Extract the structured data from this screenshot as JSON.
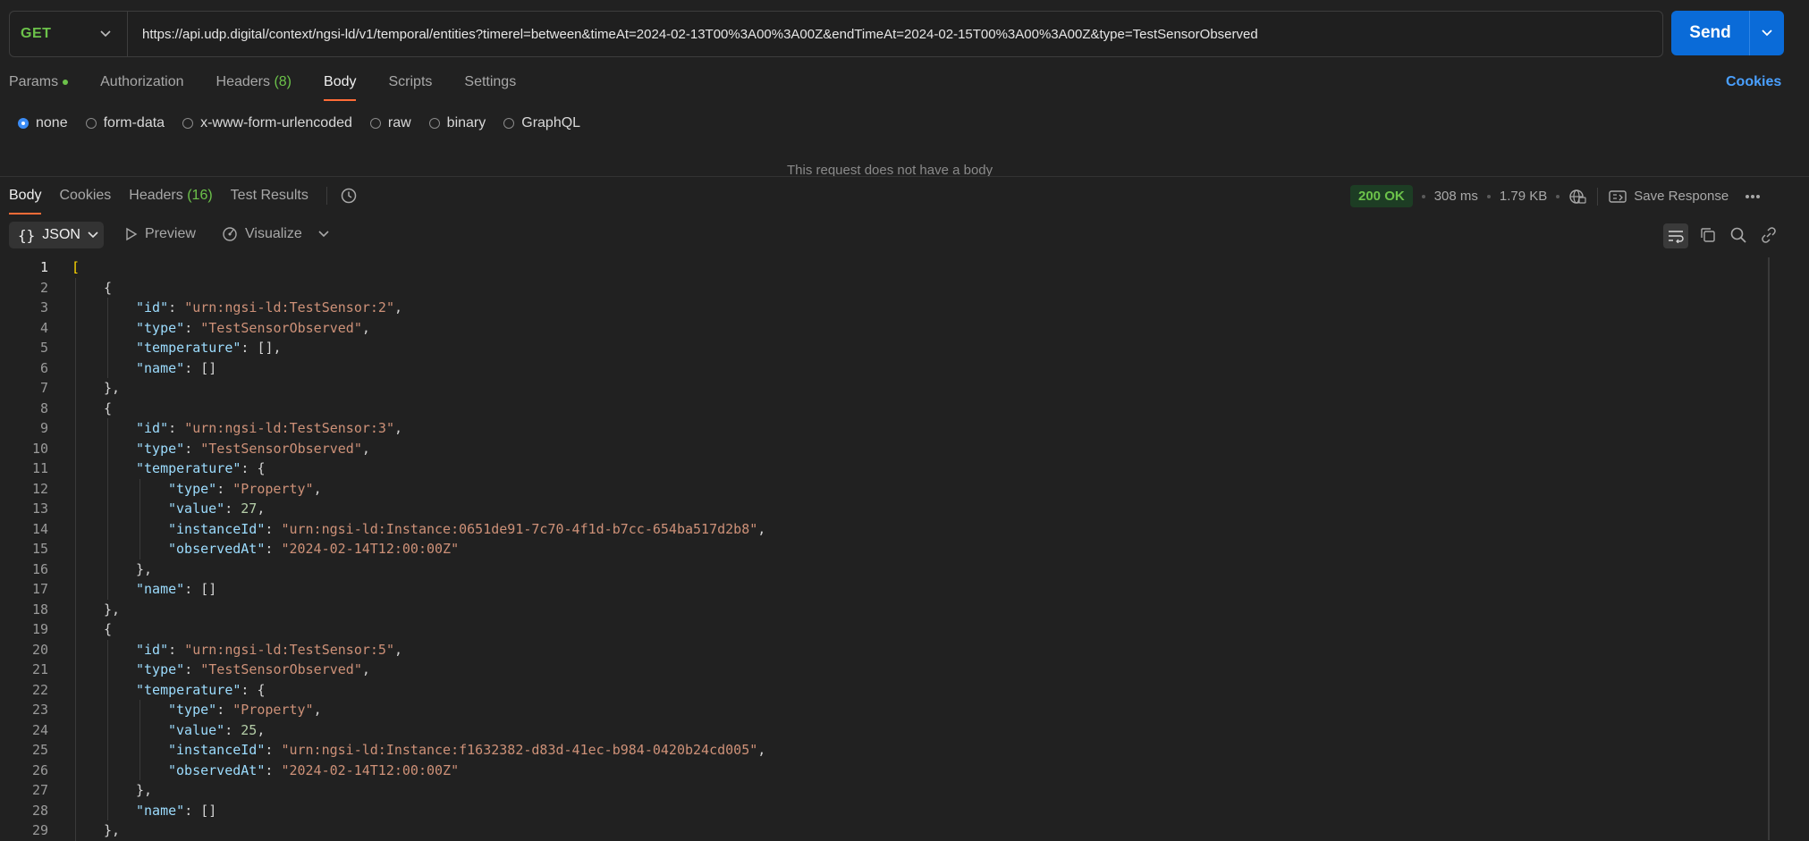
{
  "request": {
    "method": "GET",
    "url": "https://api.udp.digital/context/ngsi-ld/v1/temporal/entities?timerel=between&timeAt=2024-02-13T00%3A00%3A00Z&endTimeAt=2024-02-15T00%3A00%3A00Z&type=TestSensorObserved",
    "send_label": "Send"
  },
  "request_tabs": [
    {
      "label": "Params"
    },
    {
      "label": "Authorization"
    },
    {
      "label": "Headers",
      "count": "(8)"
    },
    {
      "label": "Body"
    },
    {
      "label": "Scripts"
    },
    {
      "label": "Settings"
    }
  ],
  "cookies_link": "Cookies",
  "body_types": [
    "none",
    "form-data",
    "x-www-form-urlencoded",
    "raw",
    "binary",
    "GraphQL"
  ],
  "selected_body_type": "none",
  "no_body_text": "This request does not have a body",
  "response_tabs": [
    {
      "label": "Body"
    },
    {
      "label": "Cookies"
    },
    {
      "label": "Headers",
      "count": "(16)"
    },
    {
      "label": "Test Results"
    }
  ],
  "response_meta": {
    "status": "200 OK",
    "time": "308 ms",
    "size": "1.79 KB",
    "save_label": "Save Response"
  },
  "response_toolbar": {
    "format": "JSON",
    "preview": "Preview",
    "visualize": "Visualize"
  },
  "colors": {
    "accent": "#ff6c37",
    "send": "#0a6bd8",
    "status_ok": "#6cc24a",
    "link": "#4aa0ff"
  },
  "code_lines": [
    {
      "n": 1,
      "indent": 0,
      "tokens": [
        [
          "br",
          "["
        ]
      ]
    },
    {
      "n": 2,
      "indent": 1,
      "tokens": [
        [
          "p",
          "{"
        ]
      ]
    },
    {
      "n": 3,
      "indent": 2,
      "tokens": [
        [
          "k",
          "\"id\""
        ],
        [
          "p",
          ": "
        ],
        [
          "s",
          "\"urn:ngsi-ld:TestSensor:2\""
        ],
        [
          "p",
          ","
        ]
      ]
    },
    {
      "n": 4,
      "indent": 2,
      "tokens": [
        [
          "k",
          "\"type\""
        ],
        [
          "p",
          ": "
        ],
        [
          "s",
          "\"TestSensorObserved\""
        ],
        [
          "p",
          ","
        ]
      ]
    },
    {
      "n": 5,
      "indent": 2,
      "tokens": [
        [
          "k",
          "\"temperature\""
        ],
        [
          "p",
          ": [],"
        ]
      ]
    },
    {
      "n": 6,
      "indent": 2,
      "tokens": [
        [
          "k",
          "\"name\""
        ],
        [
          "p",
          ": []"
        ]
      ]
    },
    {
      "n": 7,
      "indent": 1,
      "tokens": [
        [
          "p",
          "},"
        ]
      ]
    },
    {
      "n": 8,
      "indent": 1,
      "tokens": [
        [
          "p",
          "{"
        ]
      ]
    },
    {
      "n": 9,
      "indent": 2,
      "tokens": [
        [
          "k",
          "\"id\""
        ],
        [
          "p",
          ": "
        ],
        [
          "s",
          "\"urn:ngsi-ld:TestSensor:3\""
        ],
        [
          "p",
          ","
        ]
      ]
    },
    {
      "n": 10,
      "indent": 2,
      "tokens": [
        [
          "k",
          "\"type\""
        ],
        [
          "p",
          ": "
        ],
        [
          "s",
          "\"TestSensorObserved\""
        ],
        [
          "p",
          ","
        ]
      ]
    },
    {
      "n": 11,
      "indent": 2,
      "tokens": [
        [
          "k",
          "\"temperature\""
        ],
        [
          "p",
          ": {"
        ]
      ]
    },
    {
      "n": 12,
      "indent": 3,
      "tokens": [
        [
          "k",
          "\"type\""
        ],
        [
          "p",
          ": "
        ],
        [
          "s",
          "\"Property\""
        ],
        [
          "p",
          ","
        ]
      ]
    },
    {
      "n": 13,
      "indent": 3,
      "tokens": [
        [
          "k",
          "\"value\""
        ],
        [
          "p",
          ": "
        ],
        [
          "n",
          "27"
        ],
        [
          "p",
          ","
        ]
      ]
    },
    {
      "n": 14,
      "indent": 3,
      "tokens": [
        [
          "k",
          "\"instanceId\""
        ],
        [
          "p",
          ": "
        ],
        [
          "s",
          "\"urn:ngsi-ld:Instance:0651de91-7c70-4f1d-b7cc-654ba517d2b8\""
        ],
        [
          "p",
          ","
        ]
      ]
    },
    {
      "n": 15,
      "indent": 3,
      "tokens": [
        [
          "k",
          "\"observedAt\""
        ],
        [
          "p",
          ": "
        ],
        [
          "s",
          "\"2024-02-14T12:00:00Z\""
        ]
      ]
    },
    {
      "n": 16,
      "indent": 2,
      "tokens": [
        [
          "p",
          "},"
        ]
      ]
    },
    {
      "n": 17,
      "indent": 2,
      "tokens": [
        [
          "k",
          "\"name\""
        ],
        [
          "p",
          ": []"
        ]
      ]
    },
    {
      "n": 18,
      "indent": 1,
      "tokens": [
        [
          "p",
          "},"
        ]
      ]
    },
    {
      "n": 19,
      "indent": 1,
      "tokens": [
        [
          "p",
          "{"
        ]
      ]
    },
    {
      "n": 20,
      "indent": 2,
      "tokens": [
        [
          "k",
          "\"id\""
        ],
        [
          "p",
          ": "
        ],
        [
          "s",
          "\"urn:ngsi-ld:TestSensor:5\""
        ],
        [
          "p",
          ","
        ]
      ]
    },
    {
      "n": 21,
      "indent": 2,
      "tokens": [
        [
          "k",
          "\"type\""
        ],
        [
          "p",
          ": "
        ],
        [
          "s",
          "\"TestSensorObserved\""
        ],
        [
          "p",
          ","
        ]
      ]
    },
    {
      "n": 22,
      "indent": 2,
      "tokens": [
        [
          "k",
          "\"temperature\""
        ],
        [
          "p",
          ": {"
        ]
      ]
    },
    {
      "n": 23,
      "indent": 3,
      "tokens": [
        [
          "k",
          "\"type\""
        ],
        [
          "p",
          ": "
        ],
        [
          "s",
          "\"Property\""
        ],
        [
          "p",
          ","
        ]
      ]
    },
    {
      "n": 24,
      "indent": 3,
      "tokens": [
        [
          "k",
          "\"value\""
        ],
        [
          "p",
          ": "
        ],
        [
          "n",
          "25"
        ],
        [
          "p",
          ","
        ]
      ]
    },
    {
      "n": 25,
      "indent": 3,
      "tokens": [
        [
          "k",
          "\"instanceId\""
        ],
        [
          "p",
          ": "
        ],
        [
          "s",
          "\"urn:ngsi-ld:Instance:f1632382-d83d-41ec-b984-0420b24cd005\""
        ],
        [
          "p",
          ","
        ]
      ]
    },
    {
      "n": 26,
      "indent": 3,
      "tokens": [
        [
          "k",
          "\"observedAt\""
        ],
        [
          "p",
          ": "
        ],
        [
          "s",
          "\"2024-02-14T12:00:00Z\""
        ]
      ]
    },
    {
      "n": 27,
      "indent": 2,
      "tokens": [
        [
          "p",
          "},"
        ]
      ]
    },
    {
      "n": 28,
      "indent": 2,
      "tokens": [
        [
          "k",
          "\"name\""
        ],
        [
          "p",
          ": []"
        ]
      ]
    },
    {
      "n": 29,
      "indent": 1,
      "tokens": [
        [
          "p",
          "},"
        ]
      ]
    }
  ]
}
